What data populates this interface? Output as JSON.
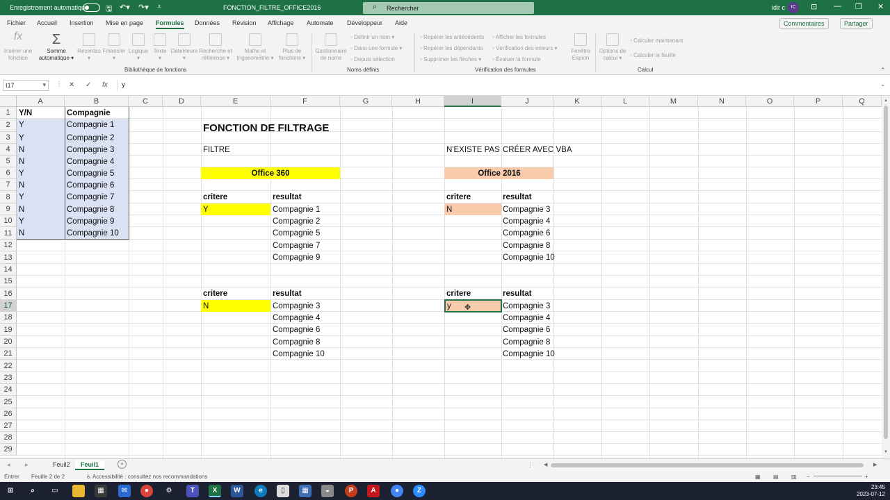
{
  "titlebar": {
    "autosave_label": "Enregistrement automatique",
    "doc_title": "FONCTION_FILTRE_OFFICE2016",
    "search_placeholder": "Rechercher",
    "user_name": "idir c",
    "avatar_initials": "IC"
  },
  "tabs": [
    "Fichier",
    "Accueil",
    "Insertion",
    "Mise en page",
    "Formules",
    "Données",
    "Révision",
    "Affichage",
    "Automate",
    "Développeur",
    "Aide"
  ],
  "active_tab": "Formules",
  "comments_label": "Commentaires",
  "share_label": "Partager",
  "ribbon": {
    "insert_function": [
      "Insérer une",
      "fonction"
    ],
    "autosum": [
      "Somme",
      "automatique ▾"
    ],
    "recent": "Récentes",
    "financial": "Financier",
    "logical": "Logique",
    "text": "Texte",
    "datetime": "DateHeure",
    "lookup": [
      "Recherche et",
      "référence ▾"
    ],
    "math": [
      "Maths et",
      "trigonométrie ▾"
    ],
    "more": [
      "Plus de",
      "fonctions ▾"
    ],
    "name_manager": [
      "Gestionnaire",
      "de noms"
    ],
    "define_name": "Définir un nom ▾",
    "use_in_formula": "Dans une formule ▾",
    "from_selection": "Depuis sélection",
    "trace_precedents": "Repérer les antécédents",
    "trace_dependents": "Repérer les dépendants",
    "remove_arrows": "Supprimer les flèches ▾",
    "show_formulas": "Afficher les formules",
    "error_checking": "Vérification des erreurs ▾",
    "evaluate": "Évaluer la formule",
    "watch_window": [
      "Fenêtre",
      "Espion"
    ],
    "calc_options": [
      "Options de",
      "calcul ▾"
    ],
    "calc_now": "Calculer maintenant",
    "calc_sheet": "Calculer la feuille",
    "groups": [
      "Bibliothèque de fonctions",
      "Noms définis",
      "Vérification des formules",
      "Calcul"
    ]
  },
  "formula_bar": {
    "name_box": "I17",
    "cancel": "✕",
    "enter": "✓",
    "fx": "fx",
    "content": "y"
  },
  "columns": [
    "A",
    "B",
    "C",
    "D",
    "E",
    "F",
    "G",
    "H",
    "I",
    "J",
    "K",
    "L",
    "M",
    "N",
    "O",
    "P",
    "Q"
  ],
  "rows": [
    "1",
    "2",
    "3",
    "4",
    "5",
    "6",
    "7",
    "8",
    "9",
    "10",
    "11",
    "12",
    "13",
    "14",
    "15",
    "16",
    "17",
    "18",
    "19",
    "20",
    "21",
    "22",
    "23",
    "24",
    "25",
    "26",
    "27",
    "28",
    "29"
  ],
  "sheet": {
    "table_header": [
      "Y/N",
      "Compagnie"
    ],
    "table_rows": [
      [
        "Y",
        "Compagnie 1"
      ],
      [
        "Y",
        "Compagnie 2"
      ],
      [
        "N",
        "Compagnie 3"
      ],
      [
        "N",
        "Compagnie 4"
      ],
      [
        "Y",
        "Compagnie 5"
      ],
      [
        "N",
        "Compagnie 6"
      ],
      [
        "Y",
        "Compagnie 7"
      ],
      [
        "N",
        "Compagnie 8"
      ],
      [
        "Y",
        "Compagnie 9"
      ],
      [
        "N",
        "Compagnie 10"
      ]
    ],
    "title": "FONCTION DE FILTRAGE",
    "filtre_label": "FILTRE",
    "office360": "Office 360",
    "nexiste_pas": "N'EXISTE PAS",
    "creer_vba": "CRÉER AVEC VBA",
    "office2016": "Office 2016",
    "critere": "critere",
    "resultat": "resultat",
    "e9": "Y",
    "f_results_1": [
      "Compagnie 1",
      "Compagnie 2",
      "Compagnie 5",
      "Compagnie 7",
      "Compagnie 9"
    ],
    "i9": "N",
    "j_results_1": [
      "Compagnie 3",
      "Compagnie 4",
      "Compagnie 6",
      "Compagnie 8",
      "Compagnie 10"
    ],
    "e17": "N",
    "f_results_2": [
      "Compagnie 3",
      "Compagnie 4",
      "Compagnie 6",
      "Compagnie 8",
      "Compagnie 10"
    ],
    "i17": "y",
    "j_results_2": [
      "Compagnie 3",
      "Compagnie 4",
      "Compagnie 6",
      "Compagnie 8",
      "Compagnie 10"
    ]
  },
  "sheet_tabs": [
    "Feuil2",
    "Feuil1"
  ],
  "active_sheet": "Feuil1",
  "status": {
    "mode": "Entrer",
    "sheet_pos": "Feuille 2 de 2",
    "accessibility": "Accessibilité : consultez nos recommandations"
  },
  "taskbar": {
    "time": "23:45",
    "date": "2023-07-12"
  },
  "colors": {
    "excel_green": "#1e7145",
    "yellow": "#ffff00",
    "salmon": "#f8cbad",
    "blue_fill": "#d9e1f2"
  }
}
